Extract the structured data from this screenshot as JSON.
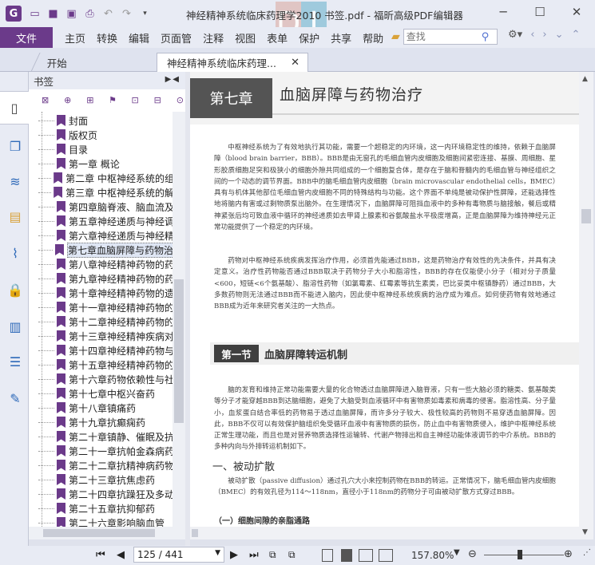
{
  "window": {
    "title": "神经精神系统临床药理学2010 书签.pdf - 福昕高级PDF编辑器",
    "watermark_letters": [
      "D",
      "I"
    ]
  },
  "menu": {
    "file": "文件",
    "items": [
      "主页",
      "转换",
      "编辑",
      "页面管",
      "注释",
      "视图",
      "表单",
      "保护",
      "共享",
      "帮助"
    ],
    "search_placeholder": "查找"
  },
  "tabs": {
    "home": "开始",
    "doc": "神经精神系统临床药理..."
  },
  "bookmarks": {
    "header": "书签",
    "items": [
      "封面",
      "版权页",
      "目录",
      "第一章 概论",
      "第二章 中枢神经系统的组",
      "第三章 中枢神经系统的解",
      "第四章脑脊液、脑血流及",
      "第五章神经递质与神经调",
      "第六章神经递质与神经精",
      "第七章血脑屏障与药物治",
      "第八章神经精神药物的药",
      "第九章神经精神药物的药",
      "第十章神经精神药物的遗",
      "第十一章神经精神药物的",
      "第十二章神经精神药物的",
      "第十三章神经精神疾病对",
      "第十四章神经精神药物与",
      "第十五章神经精神药物的",
      "第十六章药物依赖性与社",
      "第十七章中枢兴奋药",
      "第十八章镇痛药",
      "第十九章抗癫痫药",
      "第二十章镇静、催眠及抗",
      "第二十一章抗帕金森病药",
      "第二十二章抗精神病药物",
      "第二十三章抗焦虑药",
      "第二十四章抗躁狂及多动",
      "第二十五章抗抑郁药",
      "第二十六章影响脑血管"
    ],
    "selected_index": 9
  },
  "document": {
    "chapter_label": "第七章",
    "chapter_title": "血脑屏障与药物治疗",
    "para1": "中枢神经系统为了有效地执行其功能，需要一个超稳定的内环境，这一内环境稳定性的维持，依赖于血脑屏障（blood brain barrier，BBB）。BBB是由无窗孔的毛细血管内皮细胞及细胞间紧密连接、基膜、周细胞、星形胶质细胞足突和极狭小的细胞外隙共同组成的一个细胞复合体，是存在于脑和脊髓内的毛细血管与神经组织之间的一个动态的调节界面。BBB中的脑毛细血管内皮细胞（brain microvascular endothelial cells，BMEC）具有与机体其他部位毛细血管内皮细胞不同的特殊结构与功能。这个界面不单纯是被动保护性屏障，还能选择性地将脑内有害或过剩物质泵出脑外。在生理情况下，血脑屏障可阻挡血液中的多种有毒物质与脑接触，餐后或精神紧张后均可致血液中循环的神经递质如去甲肾上腺素和谷氨酸盐水平极度增高，正是血脑屏障为维持神经元正常功能提供了一个稳定的内环境。",
    "para2": "药物对中枢神经系统疾病发挥治疗作用，必须首先能通过BBB，这是药物治疗有效性的先决条件，并具有决定意义。治疗性药物能否通过BBB取决于药物分子大小和脂溶性，BBB的存在仅能使小分子（相对分子质量<600，短链<6个氨基酸）、脂溶性药物（如氯霉素、红霉素等抗生素类，巴比妥类中枢镇静药）通过BBB，大多数药物则无法通过BBB而不能进入脑内，因此使中枢神经系统疾病的治疗成为难点。如何使药物有效地通过BBB成为近年来研究者关注的一大热点。",
    "section_label": "第一节",
    "section_title": "血脑屏障转运机制",
    "para3": "脑的发育和维持正常功能需要大量的化合物透过血脑屏障进入脑脊液，只有一些大脑必须的糖类、氨基酸类等分子才能穿越BBB到达脑细胞，避免了大脑受到血液循环中有害物质如毒素和病毒的侵害。脂溶性高、分子量小，血浆蛋白结合率低的药物易于透过血脑屏障，而许多分子较大、极性较高的药物则不易穿透血脑屏障。因此，BBB不仅可以有效保护脑组织免受循环血液中有害物质的损伤，防止血中有害物质侵入，维护中枢神经系统正常生理功能，而且也是对营养物质选择性运输转、代谢产物排出和自主神经功能体液调节的中介系统。BBB的多种内向与外排转运机制如下。",
    "h2": "一、被动扩散",
    "para4": "被动扩散（passive diffusion）通过孔穴大小来控制药物在BBB的转运。正常情况下，脑毛细血管内皮细胞（BMEC）的有效孔径为114～118nm，直径小于118nm的药物分子可由被动扩散方式穿过BBB。",
    "h3": "（一）细胞间隙的亲脂通路"
  },
  "status": {
    "page": "125 / 441",
    "zoom": "157.80%"
  },
  "colors": {
    "brand": "#6b3a8a",
    "accent": "#2f6ab9"
  }
}
